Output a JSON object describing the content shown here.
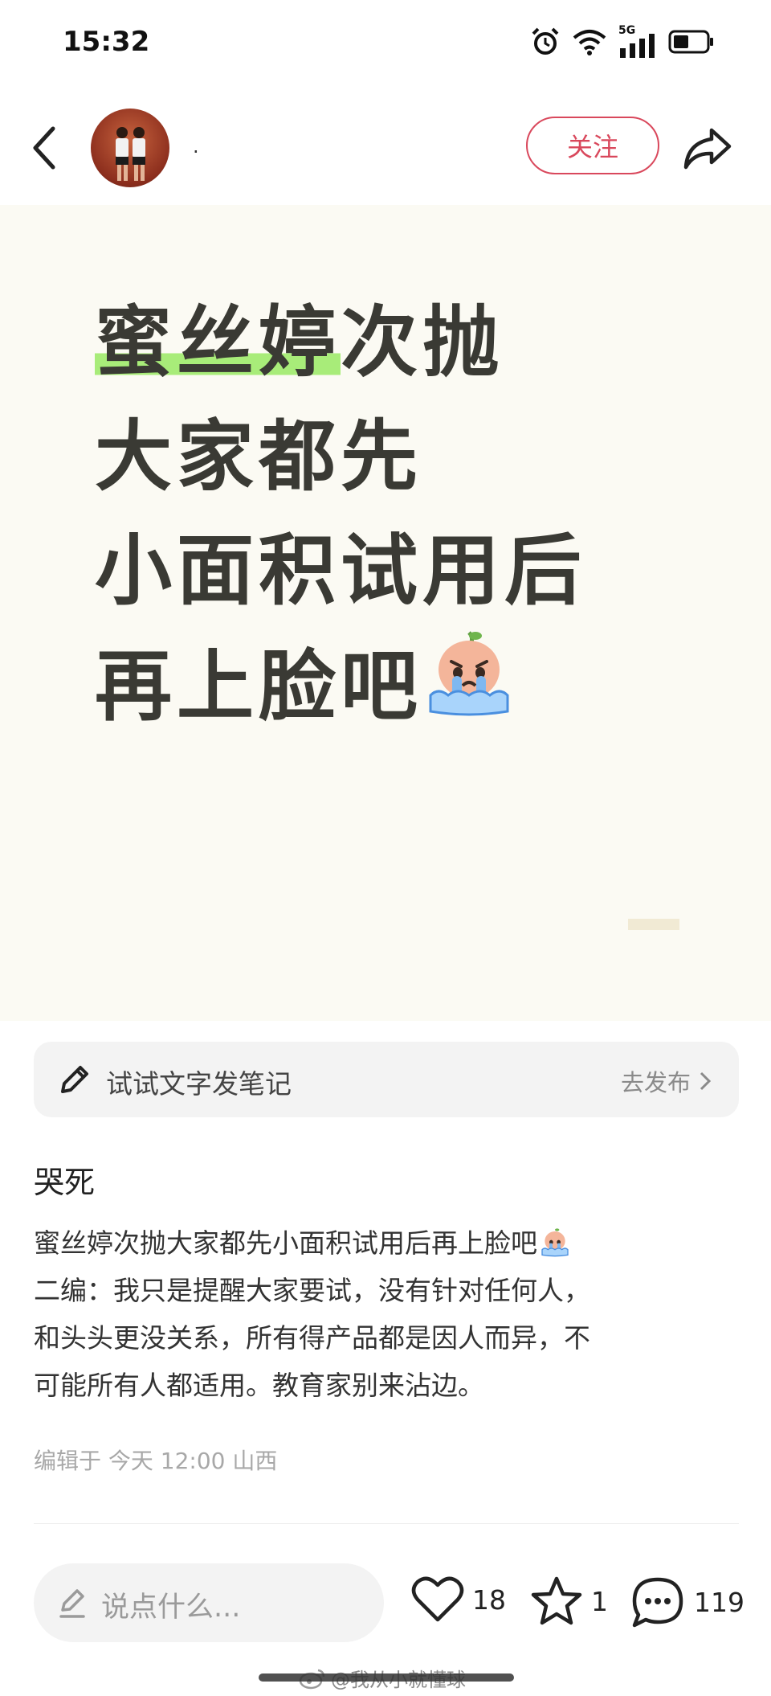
{
  "status_bar": {
    "time": "15:32",
    "network": "5G"
  },
  "header": {
    "author_name": ".",
    "follow_label": "关注"
  },
  "cover": {
    "line1_highlight": "蜜丝婷",
    "line1_rest": "次抛",
    "line2": "大家都先",
    "line3": "小面积试用后",
    "line4": "再上脸吧",
    "highlight_color": "#a8ec79"
  },
  "compose": {
    "placeholder": "试试文字发笔记",
    "action_label": "去发布"
  },
  "post": {
    "title": "哭死",
    "body_lines": [
      "蜜丝婷次抛大家都先小面积试用后再上脸吧",
      "二编：我只是提醒大家要试，没有针对任何人，",
      "和头头更没关系，所有得产品都是因人而异，不",
      "可能所有人都适用。教育家别来沾边。"
    ],
    "meta": "编辑于 今天 12:00 山西"
  },
  "bottom_bar": {
    "comment_placeholder": "说点什么...",
    "likes": "18",
    "favorites": "1",
    "comments": "119"
  },
  "watermark": "@我从小就懂球",
  "colors": {
    "accent": "#d9485c",
    "cover_bg": "#fbfaf3",
    "text_dark": "#3a3a34"
  }
}
